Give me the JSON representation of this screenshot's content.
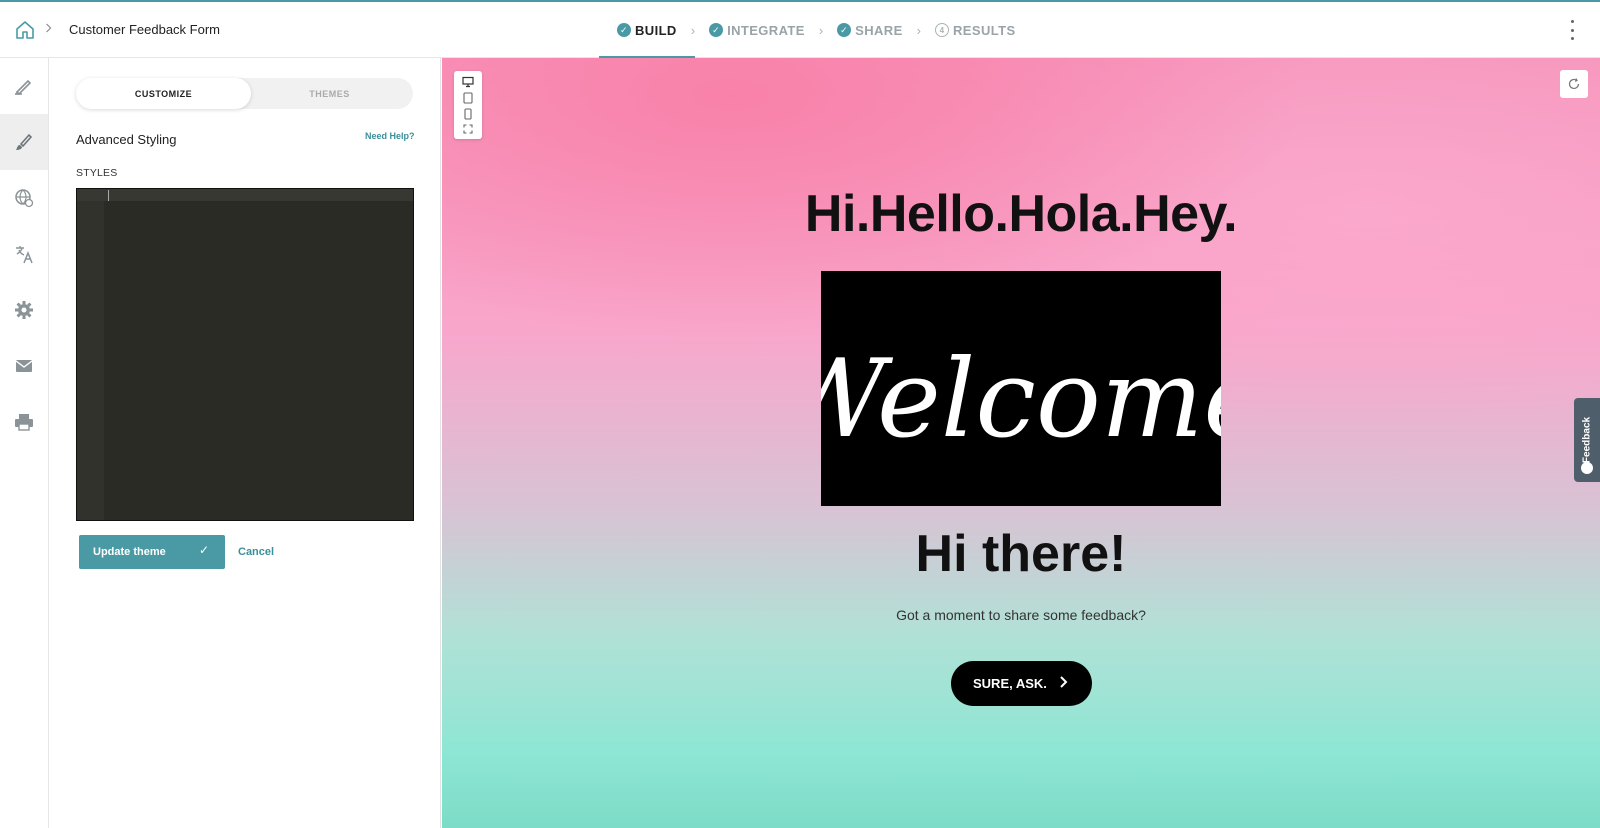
{
  "header": {
    "form_title": "Customer Feedback Form",
    "breadcrumb_sep": ">",
    "steps": [
      {
        "label": "BUILD",
        "state": "done",
        "badge": "✓"
      },
      {
        "label": "INTEGRATE",
        "state": "done",
        "badge": "✓"
      },
      {
        "label": "SHARE",
        "state": "done",
        "badge": "✓"
      },
      {
        "label": "RESULTS",
        "state": "number",
        "badge": "4"
      }
    ],
    "active_step": "BUILD",
    "accent_color": "#4a9aa5"
  },
  "rail": {
    "items": [
      {
        "icon": "pencil-icon",
        "active": false
      },
      {
        "icon": "paintbrush-icon",
        "active": true
      },
      {
        "icon": "globe-icon",
        "active": false
      },
      {
        "icon": "translate-icon",
        "active": false
      },
      {
        "icon": "gear-icon",
        "active": false
      },
      {
        "icon": "mail-icon",
        "active": false
      },
      {
        "icon": "printer-icon",
        "active": false
      }
    ]
  },
  "panel": {
    "toggle": {
      "customize": "CUSTOMIZE",
      "themes": "THEMES",
      "selected": "CUSTOMIZE"
    },
    "title": "Advanced Styling",
    "help_link": "Need Help?",
    "styles_label": "STYLES",
    "editor_value": "",
    "update_button": "Update theme",
    "cancel": "Cancel"
  },
  "preview": {
    "heading": "Hi.Hello.Hola.Hey.",
    "image_text": "Welcome",
    "title": "Hi there!",
    "subtitle": "Got a moment to share some feedback?",
    "cta": "SURE, ASK.",
    "feedback_tab": "Feedback",
    "colors": {
      "top": "#f796bd",
      "bottom": "#7cdcc6",
      "button": "#000000"
    }
  }
}
